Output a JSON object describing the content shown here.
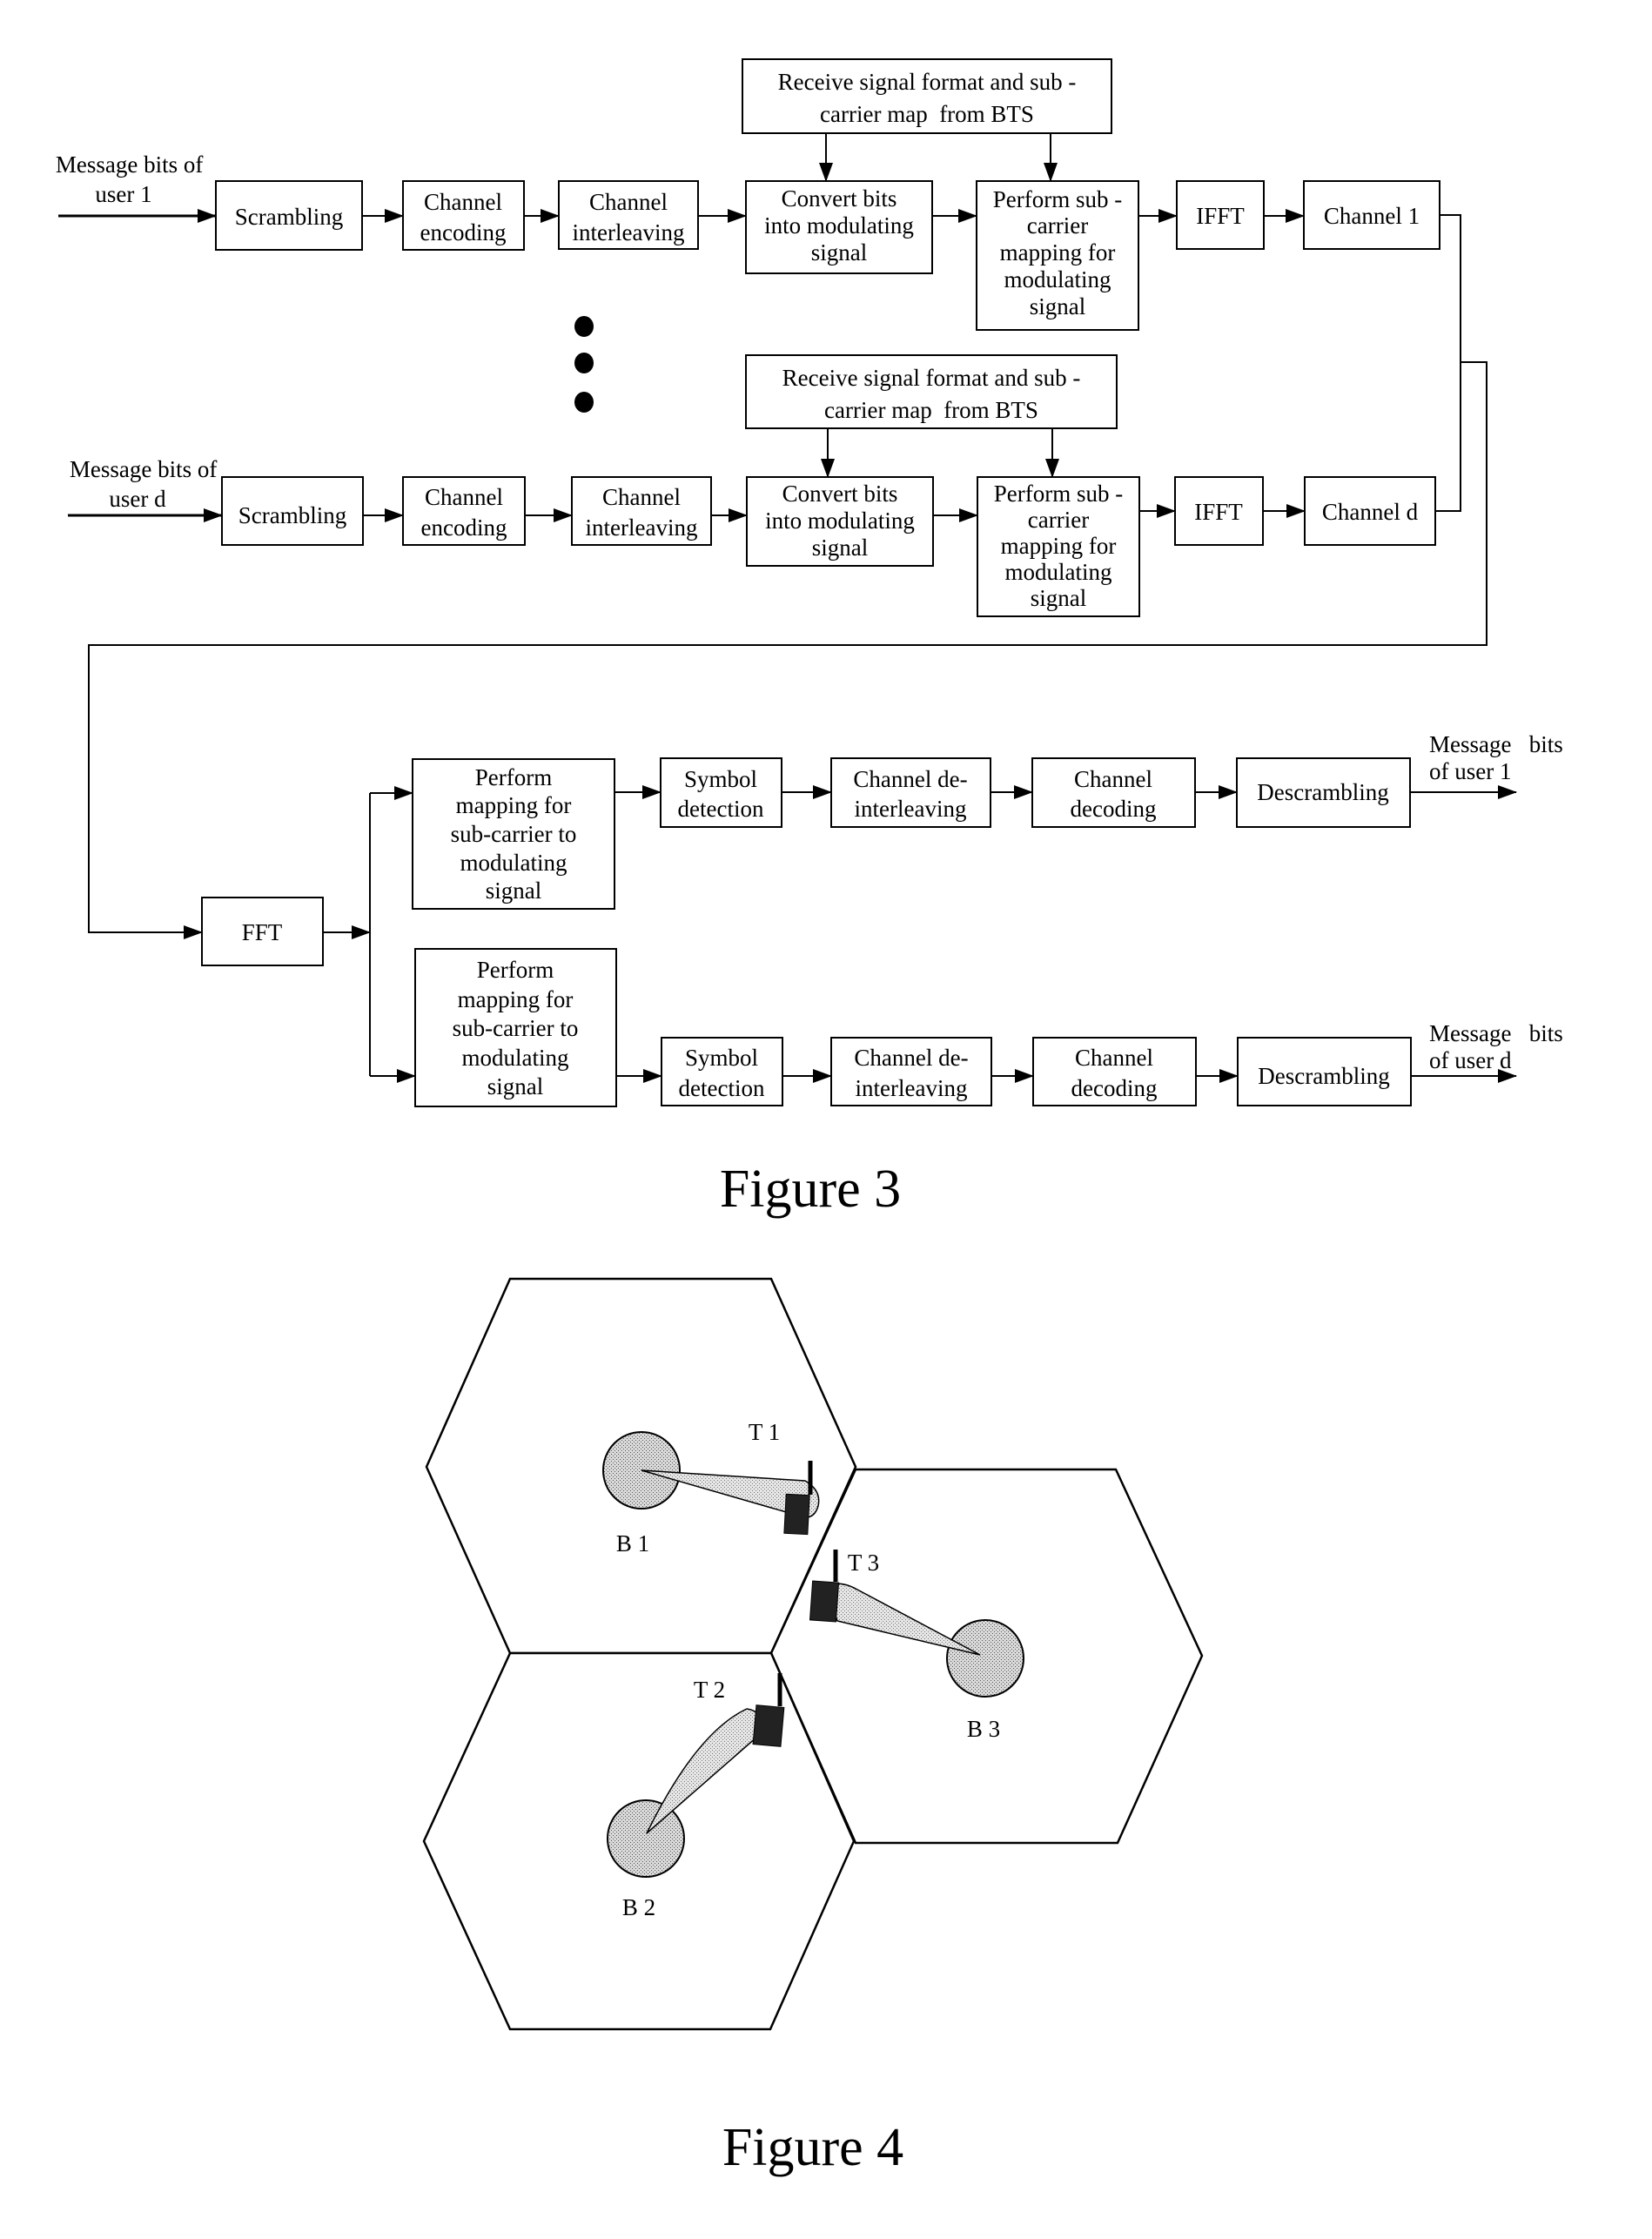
{
  "figure3": {
    "caption": "Figure 3",
    "transmitter": {
      "rows": [
        {
          "input_label": [
            "Message bits of",
            "user 1"
          ],
          "control_box": [
            "Receive signal format and sub -",
            "carrier map  from BTS"
          ],
          "blocks": [
            {
              "id": "scrambling",
              "lines": [
                "Scrambling"
              ]
            },
            {
              "id": "channel-encoding",
              "lines": [
                "Channel",
                "encoding"
              ]
            },
            {
              "id": "channel-interleaving",
              "lines": [
                "Channel",
                "interleaving"
              ]
            },
            {
              "id": "convert-bits",
              "lines": [
                "Convert bits",
                "into modulating",
                "signal"
              ]
            },
            {
              "id": "subcarrier-mapping",
              "lines": [
                "Perform sub -",
                "carrier",
                "mapping for",
                "modulating",
                "signal"
              ]
            },
            {
              "id": "ifft",
              "lines": [
                "IFFT"
              ]
            },
            {
              "id": "channel",
              "lines": [
                "Channel 1"
              ]
            }
          ]
        },
        {
          "input_label": [
            "Message bits of",
            "user d"
          ],
          "control_box": [
            "Receive signal format and sub -",
            "carrier map  from BTS"
          ],
          "blocks": [
            {
              "id": "scrambling",
              "lines": [
                "Scrambling"
              ]
            },
            {
              "id": "channel-encoding",
              "lines": [
                "Channel",
                "encoding"
              ]
            },
            {
              "id": "channel-interleaving",
              "lines": [
                "Channel",
                "interleaving"
              ]
            },
            {
              "id": "convert-bits",
              "lines": [
                "Convert bits",
                "into modulating",
                "signal"
              ]
            },
            {
              "id": "subcarrier-mapping",
              "lines": [
                "Perform sub -",
                "carrier",
                "mapping for",
                "modulating",
                "signal"
              ]
            },
            {
              "id": "ifft",
              "lines": [
                "IFFT"
              ]
            },
            {
              "id": "channel",
              "lines": [
                "Channel d"
              ]
            }
          ]
        }
      ],
      "ellipsis": "vertical-dots"
    },
    "receiver": {
      "fft": "FFT",
      "rows": [
        {
          "blocks": [
            {
              "id": "subcarrier-demapping",
              "lines": [
                "Perform",
                "mapping for",
                "sub-carrier to",
                "modulating",
                "signal"
              ]
            },
            {
              "id": "symbol-detection",
              "lines": [
                "Symbol",
                "detection"
              ]
            },
            {
              "id": "channel-deinterleaving",
              "lines": [
                "Channel de-",
                "interleaving"
              ]
            },
            {
              "id": "channel-decoding",
              "lines": [
                "Channel",
                "decoding"
              ]
            },
            {
              "id": "descrambling",
              "lines": [
                "Descrambling"
              ]
            }
          ],
          "output_label": [
            "Message   bits",
            "of user 1"
          ]
        },
        {
          "blocks": [
            {
              "id": "subcarrier-demapping",
              "lines": [
                "Perform",
                "mapping for",
                "sub-carrier to",
                "modulating",
                "signal"
              ]
            },
            {
              "id": "symbol-detection",
              "lines": [
                "Symbol",
                "detection"
              ]
            },
            {
              "id": "channel-deinterleaving",
              "lines": [
                "Channel de-",
                "interleaving"
              ]
            },
            {
              "id": "channel-decoding",
              "lines": [
                "Channel",
                "decoding"
              ]
            },
            {
              "id": "descrambling",
              "lines": [
                "Descrambling"
              ]
            }
          ],
          "output_label": [
            "Message   bits",
            "of user d"
          ]
        }
      ]
    }
  },
  "figure4": {
    "caption": "Figure 4",
    "cells": [
      {
        "bts_label": "B 1",
        "terminal_label": "T 1"
      },
      {
        "bts_label": "B 2",
        "terminal_label": "T 2"
      },
      {
        "bts_label": "B 3",
        "terminal_label": "T 3"
      }
    ]
  }
}
